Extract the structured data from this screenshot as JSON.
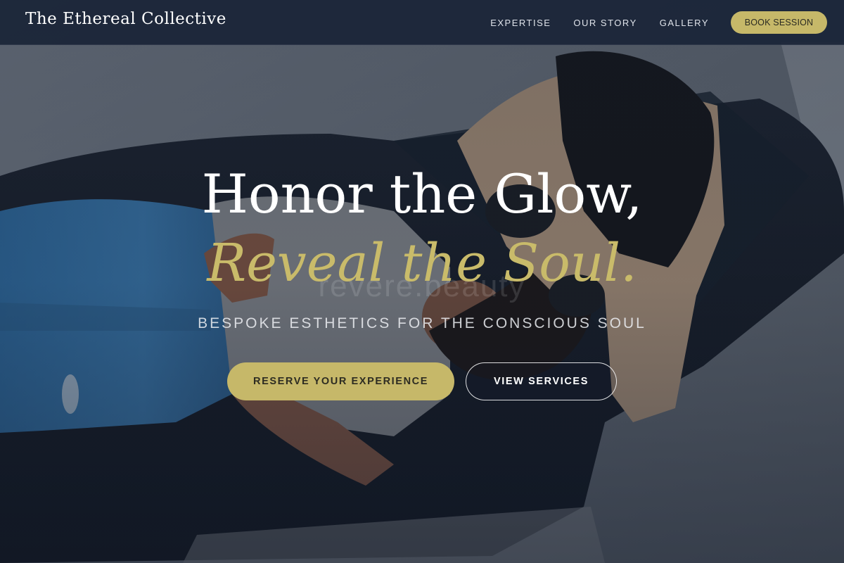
{
  "brand": {
    "name": "The Ethereal Collective"
  },
  "nav": {
    "items": [
      {
        "label": "EXPERTISE"
      },
      {
        "label": "OUR STORY"
      },
      {
        "label": "GALLERY"
      }
    ],
    "book_label": "BOOK SESSION"
  },
  "hero": {
    "title_line1": "Honor the Glow,",
    "title_line2": "Reveal the Soul.",
    "watermark": "revere.beauty",
    "subtitle": "BESPOKE ESTHETICS FOR THE CONSCIOUS SOUL",
    "primary_cta": "RESERVE YOUR EXPERIENCE",
    "secondary_cta": "VIEW SERVICES"
  },
  "colors": {
    "accent_gold": "#c6b869",
    "title_gold": "#c9bb6a",
    "navbar_bg": "#1b2538",
    "text_white": "#ffffff"
  }
}
